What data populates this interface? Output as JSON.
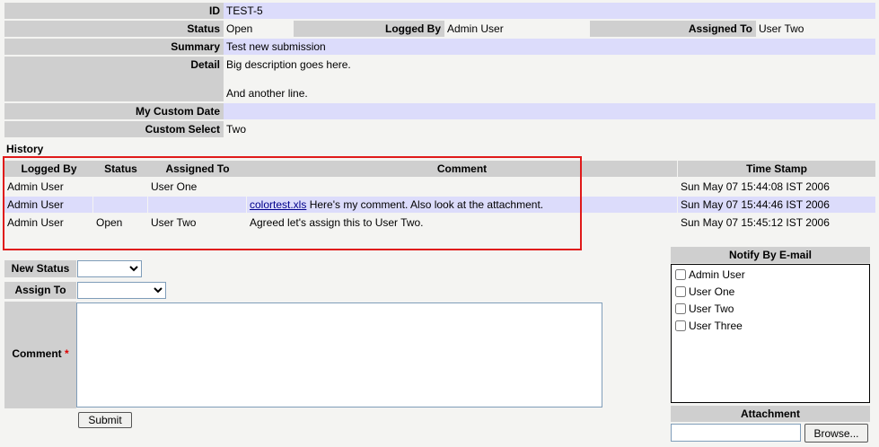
{
  "issue": {
    "id_label": "ID",
    "id_value": "TEST-5",
    "status_label": "Status",
    "status_value": "Open",
    "logged_by_label": "Logged By",
    "logged_by_value": "Admin User",
    "assigned_to_label": "Assigned To",
    "assigned_to_value": "User Two",
    "summary_label": "Summary",
    "summary_value": "Test new submission",
    "detail_label": "Detail",
    "detail_line1": "Big description goes here.",
    "detail_line2": "And another line.",
    "custom_date_label": "My Custom Date",
    "custom_date_value": "",
    "custom_select_label": "Custom Select",
    "custom_select_value": "Two"
  },
  "history": {
    "title": "History",
    "columns": [
      "Logged By",
      "Status",
      "Assigned To",
      "Comment",
      "Time Stamp"
    ],
    "rows": [
      {
        "logged_by": "Admin User",
        "status": "",
        "assigned_to": "User One",
        "attachment": "",
        "comment": "",
        "timestamp": "Sun May 07 15:44:08 IST 2006"
      },
      {
        "logged_by": "Admin User",
        "status": "",
        "assigned_to": "",
        "attachment": "colortest.xls",
        "comment": "Here's my comment. Also look at the attachment.",
        "timestamp": "Sun May 07 15:44:46 IST 2006"
      },
      {
        "logged_by": "Admin User",
        "status": "Open",
        "assigned_to": "User Two",
        "attachment": "",
        "comment": "Agreed let's assign this to User Two.",
        "timestamp": "Sun May 07 15:45:12 IST 2006"
      }
    ]
  },
  "form": {
    "new_status_label": "New Status",
    "new_status_value": "",
    "assign_to_label": "Assign To",
    "assign_to_value": "",
    "comment_label": "Comment",
    "required_mark": "*",
    "comment_value": "",
    "submit_label": "Submit"
  },
  "notify": {
    "title": "Notify By E-mail",
    "users": [
      "Admin User",
      "User One",
      "User Two",
      "User Three"
    ]
  },
  "attachment": {
    "title": "Attachment",
    "file_value": "",
    "browse_label": "Browse..."
  },
  "colors": {
    "label_bg": "#cfcfcf",
    "highlight_bg": "#dcdcfb",
    "annotation_box": "#e01a1a"
  }
}
